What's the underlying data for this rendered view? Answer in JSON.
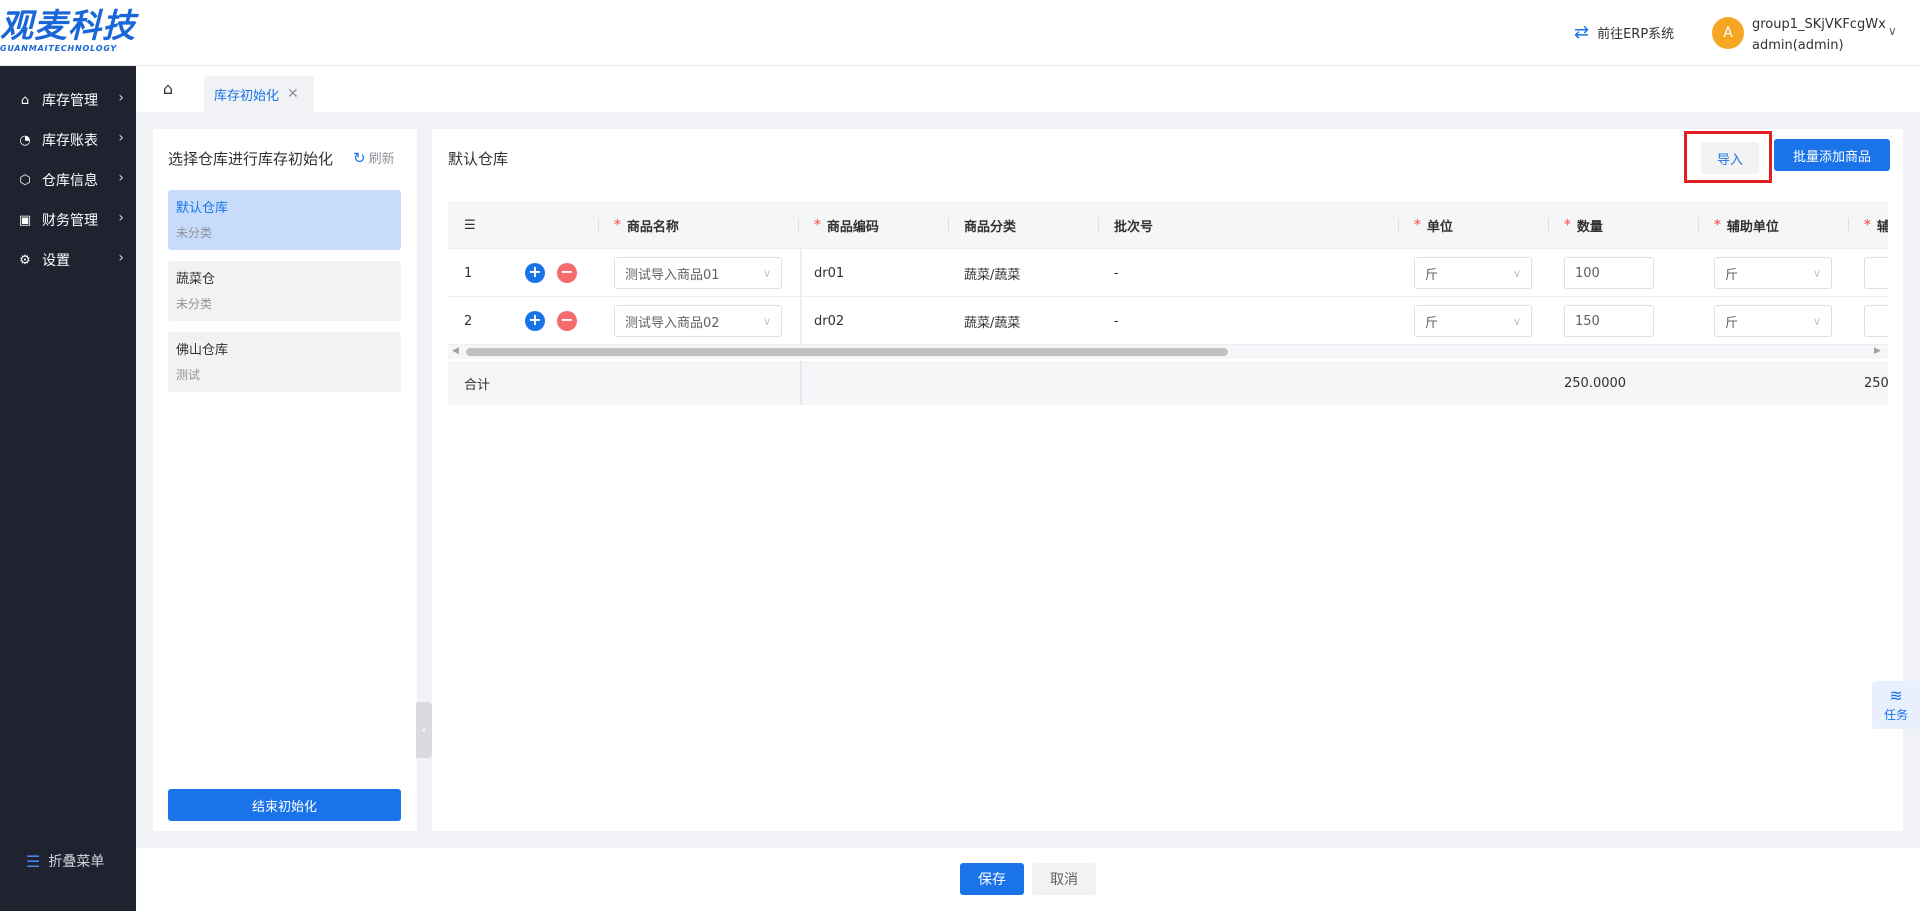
{
  "brand": {
    "name": "观麦科技",
    "sub": "GUANMAITECHNOLOGY",
    "color": "#1966d8"
  },
  "header": {
    "erp_link": "前往ERP系统",
    "avatar_letter": "A",
    "user_group": "group1_SKjVKFcgWx",
    "user_name": "admin(admin)"
  },
  "sidebar": {
    "items": [
      {
        "label": "库存管理",
        "icon": "home-icon"
      },
      {
        "label": "库存账表",
        "icon": "pie-chart-icon"
      },
      {
        "label": "仓库信息",
        "icon": "cube-icon"
      },
      {
        "label": "财务管理",
        "icon": "wallet-icon"
      },
      {
        "label": "设置",
        "icon": "gear-icon"
      }
    ],
    "fold_label": "折叠菜单"
  },
  "tabs": {
    "active": "库存初始化"
  },
  "left_panel": {
    "title": "选择仓库进行库存初始化",
    "refresh": "刷新",
    "warehouses": [
      {
        "name": "默认仓库",
        "category": "未分类"
      },
      {
        "name": "蔬菜仓",
        "category": "未分类"
      },
      {
        "name": "佛山仓库",
        "category": "测试"
      }
    ],
    "finish_button": "结束初始化"
  },
  "main": {
    "title": "默认仓库",
    "import_button": "导入",
    "batch_add_button": "批量添加商品",
    "columns": {
      "product_name": "商品名称",
      "product_code": "商品编码",
      "category": "商品分类",
      "batch_no": "批次号",
      "unit": "单位",
      "quantity": "数量",
      "aux_unit": "辅助单位",
      "aux_partial": "辅"
    },
    "rows": [
      {
        "index": "1",
        "name": "测试导入商品01",
        "code": "dr01",
        "category": "蔬菜/蔬菜",
        "batch": "-",
        "unit": "斤",
        "quantity": "100",
        "aux_unit": "斤"
      },
      {
        "index": "2",
        "name": "测试导入商品02",
        "code": "dr02",
        "category": "蔬菜/蔬菜",
        "batch": "-",
        "unit": "斤",
        "quantity": "150",
        "aux_unit": "斤"
      }
    ],
    "footer": {
      "label": "合计",
      "quantity_total": "250.0000",
      "aux_total_partial": "250."
    }
  },
  "bottom": {
    "save": "保存",
    "cancel": "取消"
  },
  "task_float": {
    "label": "任务"
  },
  "colors": {
    "primary": "#1a73e8",
    "danger": "#f56c6c",
    "sidebar_bg": "#1f2330",
    "highlight_border": "#e02020"
  }
}
